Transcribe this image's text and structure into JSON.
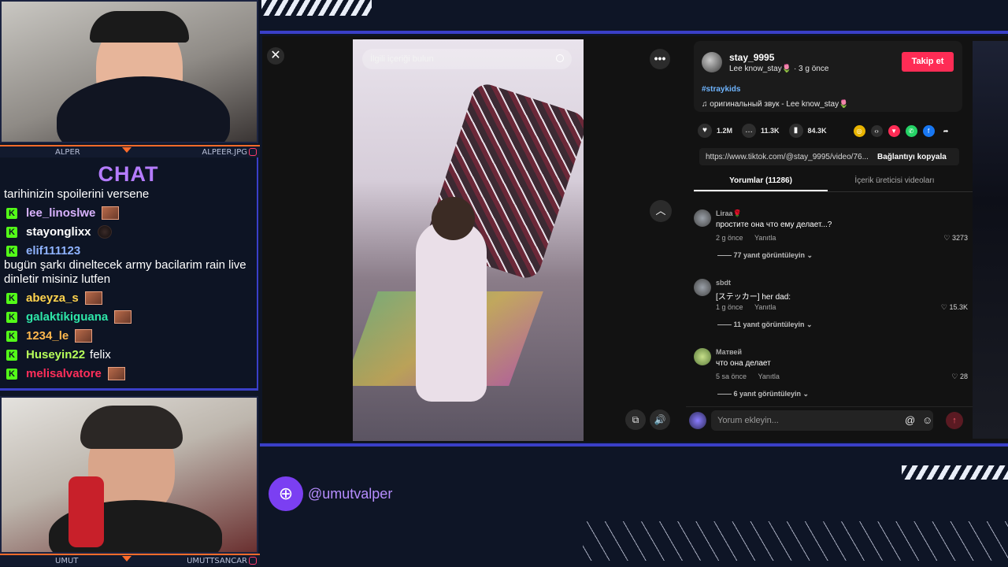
{
  "webcams": {
    "top": {
      "name_left": "ALPER",
      "name_right": "ALPEER.JPG"
    },
    "bottom": {
      "name_left": "UMUT",
      "name_right": "UMUTTSANCAR"
    }
  },
  "chat": {
    "title": "CHAT",
    "messages": [
      {
        "user": "",
        "color": "#ffffff",
        "text": "tarihinizin spoilerini versene",
        "badge": false,
        "emote": false
      },
      {
        "user": "lee_linoslwe",
        "color": "#d9b3ff",
        "text": "",
        "badge": true,
        "emote": true
      },
      {
        "user": "stayonglixx",
        "color": "#ffffff",
        "text": "",
        "badge": true,
        "emote": "dark"
      },
      {
        "user": "elif111123",
        "color": "#8fb3ff",
        "text": "bugün şarkı dineltecek army bacilarim rain live dinletir misiniz lutfen",
        "badge": true,
        "emote": false
      },
      {
        "user": "abeyza_s",
        "color": "#ffd34d",
        "text": "",
        "badge": true,
        "emote": true
      },
      {
        "user": "galaktikiguana",
        "color": "#2ee6a8",
        "text": "",
        "badge": true,
        "emote": true
      },
      {
        "user": "1234_le",
        "color": "#ffb84d",
        "text": "",
        "badge": true,
        "emote": true
      },
      {
        "user": "Huseyin22",
        "color": "#b7ff5a",
        "text": "felix",
        "badge": true,
        "emote": false
      },
      {
        "user": "melisalvatore",
        "color": "#ff2e5a",
        "text": "",
        "badge": true,
        "emote": true
      }
    ]
  },
  "video": {
    "search_placeholder": "İlgili içeriği bulun"
  },
  "post": {
    "author": "stay_9995",
    "display_name": "Lee know_stay🌷 · 3 g önce",
    "follow_label": "Takip et",
    "hashtag": "#straykids",
    "sound": "♫  оригинальный звук - Lee know_stay🌷",
    "likes": "1.2M",
    "comments_count": "11.3K",
    "saves": "84.3K",
    "link": "https://www.tiktok.com/@stay_9995/video/76...",
    "copy_label": "Bağlantıyı kopyala"
  },
  "tabs": [
    {
      "label": "Yorumlar (11286)",
      "active": true
    },
    {
      "label": "İçerik üreticisi videoları",
      "active": false
    }
  ],
  "comments": [
    {
      "user": "Liraa🌹",
      "text": "простите она что ему делает...?",
      "time": "2 g önce",
      "reply": "Yanıtla",
      "likes": "3273",
      "replies": "—— 77 yanıt görüntüleyin ⌄"
    },
    {
      "user": "sbdt",
      "text": "[ステッカー] her dad:",
      "time": "1 g önce",
      "reply": "Yanıtla",
      "likes": "15.3K",
      "replies": "—— 11 yanıt görüntüleyin ⌄"
    },
    {
      "user": "Матвей",
      "text": "что она делает",
      "time": "5 sa önce",
      "reply": "Yanıtla",
      "likes": "28",
      "replies": "—— 6 yanıt görüntüleyin ⌄"
    }
  ],
  "comment_input_placeholder": "Yorum ekleyin...",
  "social": {
    "handle": "@umutvalper"
  },
  "colors": {
    "accent": "#3a3fc8",
    "follow": "#fe2c55",
    "chat_title": "#b57cff",
    "kick_green": "#53fc18"
  }
}
